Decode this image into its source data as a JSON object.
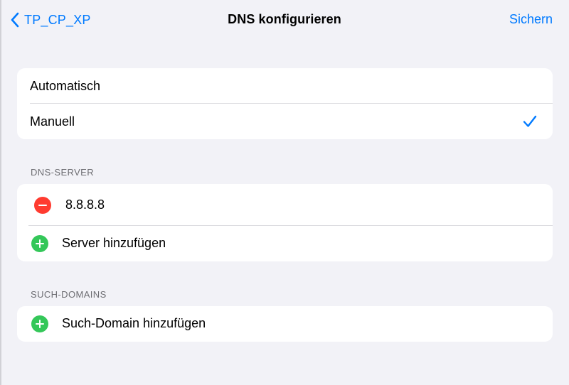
{
  "navbar": {
    "back_label": "TP_CP_XP",
    "title": "DNS konfigurieren",
    "save_label": "Sichern"
  },
  "mode": {
    "options": [
      {
        "label": "Automatisch",
        "selected": false
      },
      {
        "label": "Manuell",
        "selected": true
      }
    ]
  },
  "dns_servers": {
    "header": "DNS-SERVER",
    "servers": [
      "8.8.8.8"
    ],
    "add_label": "Server hinzufügen"
  },
  "search_domains": {
    "header": "SUCH-DOMAINS",
    "add_label": "Such-Domain hinzufügen"
  },
  "colors": {
    "accent": "#007aff",
    "delete": "#ff3b30",
    "add": "#34c759",
    "background": "#f2f2f7"
  }
}
